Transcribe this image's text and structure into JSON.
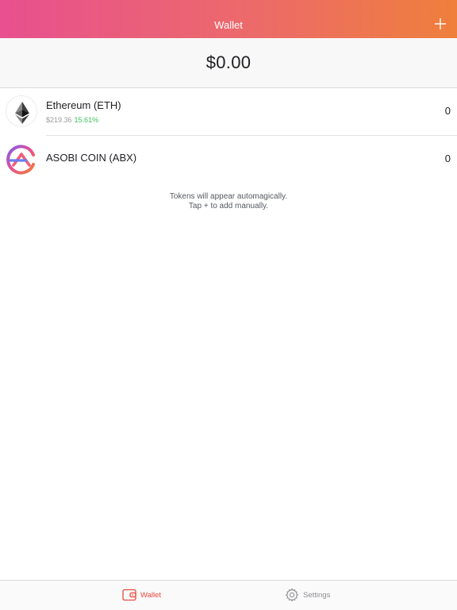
{
  "header": {
    "title": "Wallet",
    "add_icon": "plus-icon",
    "gradient_start": "#e8508f",
    "gradient_end": "#ef7f3c"
  },
  "balance": {
    "total": "$0.00"
  },
  "tokens": [
    {
      "name": "Ethereum (ETH)",
      "price": "$219.36",
      "change": "15.61%",
      "balance": "0",
      "icon": "ethereum-icon"
    },
    {
      "name": "ASOBI COIN (ABX)",
      "balance": "0",
      "icon": "asobi-coin-icon"
    }
  ],
  "hint": {
    "line1": "Tokens will appear automagically.",
    "line2": "Tap + to add manually."
  },
  "tabbar": {
    "tabs": [
      {
        "label": "Wallet",
        "icon": "wallet-icon",
        "active": true
      },
      {
        "label": "Settings",
        "icon": "gear-icon",
        "active": false
      }
    ],
    "active_color": "#e94b3c",
    "inactive_color": "#8e8e93"
  },
  "colors": {
    "positive_change": "#3cc35a"
  }
}
